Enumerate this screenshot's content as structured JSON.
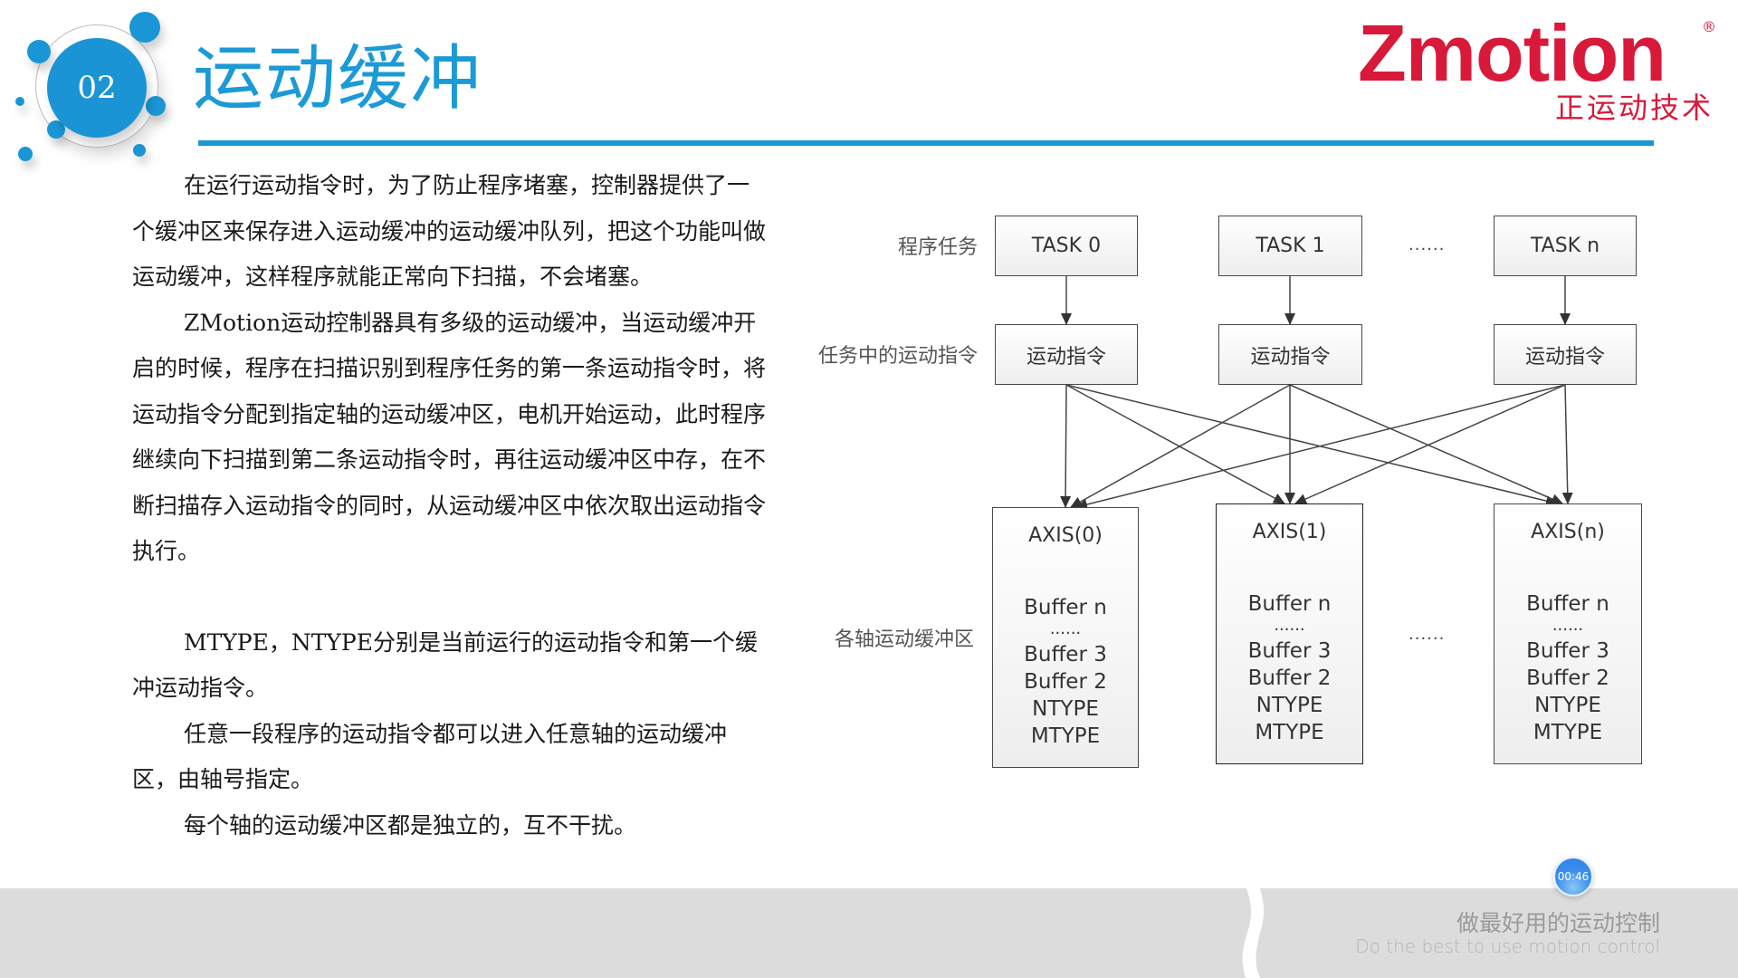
{
  "header": {
    "section_number": "02",
    "title": "运动缓冲"
  },
  "logo": {
    "wordmark": "Zmotion",
    "registered_mark": "®",
    "chinese_name": "正运动技术"
  },
  "body": {
    "paragraphs": [
      "在运行运动指令时，为了防止程序堵塞，控制器提供了一个缓冲区来保存进入运动缓冲的运动缓冲队列，把这个功能叫做运动缓冲，这样程序就能正常向下扫描，不会堵塞。",
      "ZMotion运动控制器具有多级的运动缓冲，当运动缓冲开启的时候，程序在扫描识别到程序任务的第一条运动指令时，将运动指令分配到指定轴的运动缓冲区，电机开始运动，此时程序继续向下扫描到第二条运动指令时，再往运动缓冲区中存，在不断扫描存入运动指令的同时，从运动缓冲区中依次取出运动指令执行。",
      "MTYPE，NTYPE分别是当前运行的运动指令和第一个缓冲运动指令。",
      "任意一段程序的运动指令都可以进入任意轴的运动缓冲区，由轴号指定。",
      "每个轴的运动缓冲区都是独立的，互不干扰。"
    ]
  },
  "diagram": {
    "row_labels": {
      "tasks": "程序任务",
      "commands": "任务中的运动指令",
      "buffers": "各轴运动缓冲区"
    },
    "tasks": [
      "TASK 0",
      "TASK 1",
      "TASK n"
    ],
    "commands": [
      "运动指令",
      "运动指令",
      "运动指令"
    ],
    "task_ellipsis": "......",
    "axis_ellipsis": "......",
    "axes": [
      {
        "title": "AXIS(0)",
        "buffers": [
          "Buffer  n",
          "......",
          "Buffer 3",
          "Buffer 2",
          "NTYPE",
          "MTYPE"
        ]
      },
      {
        "title": "AXIS(1)",
        "buffers": [
          "Buffer  n",
          "......",
          "Buffer 3",
          "Buffer 2",
          "NTYPE",
          "MTYPE"
        ]
      },
      {
        "title": "AXIS(n)",
        "buffers": [
          "Buffer  n",
          "......",
          "Buffer 3",
          "Buffer 2",
          "NTYPE",
          "MTYPE"
        ]
      }
    ],
    "connections": "each motion command connects to every axis buffer"
  },
  "footer": {
    "slogan_cn": "做最好用的运动控制",
    "slogan_en": "Do the best to use motion control",
    "timer": "00:46"
  },
  "colors": {
    "accent_blue": "#1a97d3",
    "brand_red": "#d8193a",
    "footer_gray": "#dcdcdc"
  }
}
